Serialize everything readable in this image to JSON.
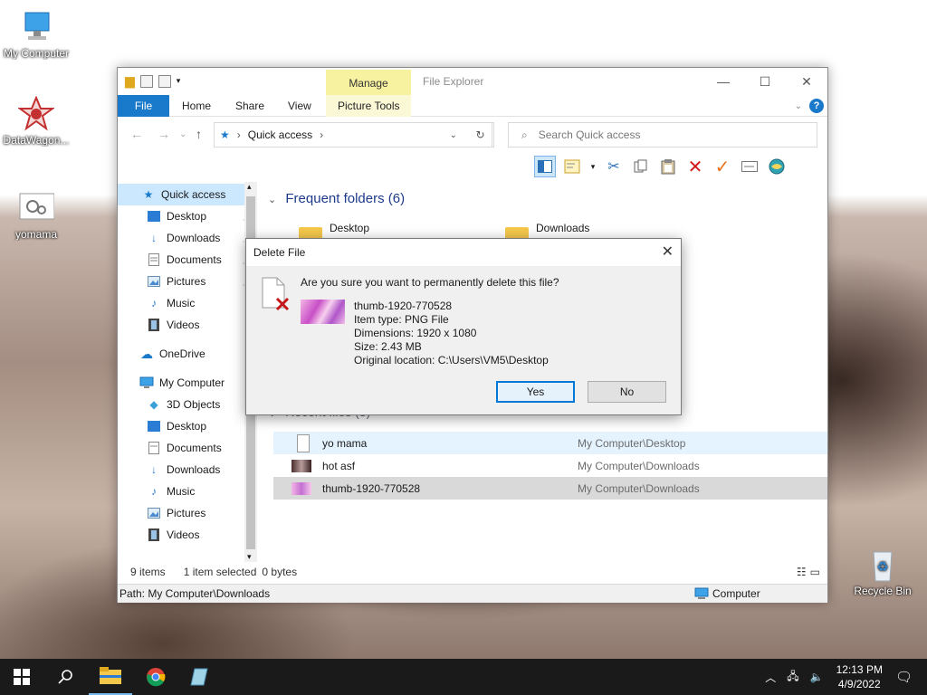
{
  "desktop": {
    "icons": [
      {
        "label": "My Computer"
      },
      {
        "label": "DataWagon..."
      },
      {
        "label": "yomama"
      },
      {
        "label": "Recycle Bin"
      }
    ]
  },
  "explorer": {
    "title": "File Explorer",
    "manage_tab": "Manage",
    "tabs": {
      "file": "File",
      "home": "Home",
      "share": "Share",
      "view": "View",
      "picture_tools": "Picture Tools"
    },
    "address": {
      "location": "Quick access"
    },
    "search": {
      "placeholder": "Search Quick access"
    },
    "nav": {
      "quick_access": "Quick access",
      "qa_items": [
        "Desktop",
        "Downloads",
        "Documents",
        "Pictures",
        "Music",
        "Videos"
      ],
      "onedrive": "OneDrive",
      "my_computer": "My Computer",
      "mc_items": [
        "3D Objects",
        "Desktop",
        "Documents",
        "Downloads",
        "Music",
        "Pictures",
        "Videos"
      ]
    },
    "content": {
      "frequent_header": "Frequent folders (6)",
      "frequent": [
        "Desktop",
        "Downloads"
      ],
      "recent_header": "Recent files (3)",
      "recent": [
        {
          "name": "yo mama",
          "path": "My Computer\\Desktop"
        },
        {
          "name": "hot asf",
          "path": "My Computer\\Downloads"
        },
        {
          "name": "thumb-1920-770528",
          "path": "My Computer\\Downloads"
        }
      ]
    },
    "status": {
      "items": "9 items",
      "selected": "1 item selected",
      "size": "0 bytes"
    },
    "pathbar": {
      "path": "Path: My Computer\\Downloads",
      "computer": "Computer"
    }
  },
  "dialog": {
    "title": "Delete File",
    "question": "Are you sure you want to permanently delete this file?",
    "file_name": "thumb-1920-770528",
    "item_type": "Item type: PNG File",
    "dimensions": "Dimensions: 1920 x 1080",
    "size": "Size: 2.43 MB",
    "location": "Original location: C:\\Users\\VM5\\Desktop",
    "yes": "Yes",
    "no": "No"
  },
  "taskbar": {
    "time": "12:13 PM",
    "date": "4/9/2022"
  },
  "colors": {
    "accent": "#1979ca",
    "manage": "#f7f2a0",
    "selection": "#cce8ff"
  }
}
